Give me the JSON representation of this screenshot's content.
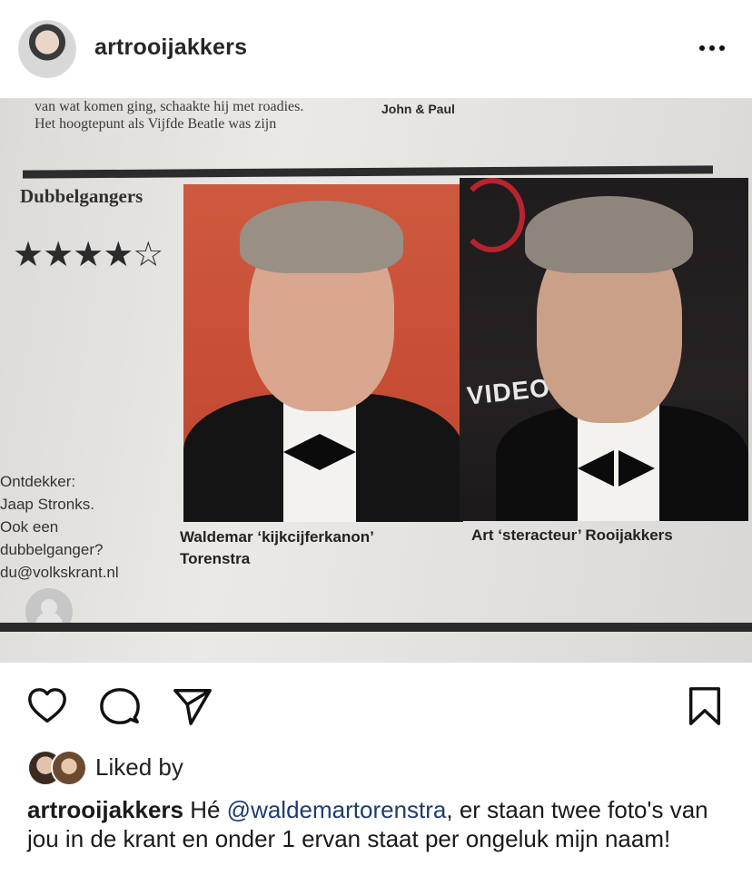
{
  "header": {
    "username": "artrooijakkers",
    "more_icon": "more-horizontal-icon"
  },
  "post_image": {
    "top_text_line1": "van wat komen ging, schaakte hij met roadies.",
    "top_text_line2": "Het hoogtepunt als Vijfde Beatle was zijn",
    "top_right_text": "John & Paul",
    "section_title": "Dubbelgangers",
    "rating_stars": "★★★★☆",
    "rating": 4,
    "rating_max": 5,
    "side_lines": [
      "Ontdekker:",
      "Jaap Stronks.",
      "Ook een",
      "dubbelganger?",
      "du@volkskrant.nl"
    ],
    "caption_left_line1": "Waldemar ‘kijkcijferkanon’",
    "caption_left_line2": "Torenstra",
    "caption_right": "Art ‘steracteur’ Rooijakkers",
    "right_photo_sign": "VIDEO"
  },
  "actions": {
    "like_icon": "heart-icon",
    "comment_icon": "comment-icon",
    "share_icon": "send-icon",
    "save_icon": "bookmark-icon"
  },
  "likes": {
    "label": "Liked by"
  },
  "caption": {
    "username": "artrooijakkers",
    "text_before": " Hé ",
    "mention": "@waldemartorenstra",
    "text_after": ", er staan twee foto's van jou in de krant en onder 1 ervan staat per ongeluk mijn naam!"
  }
}
